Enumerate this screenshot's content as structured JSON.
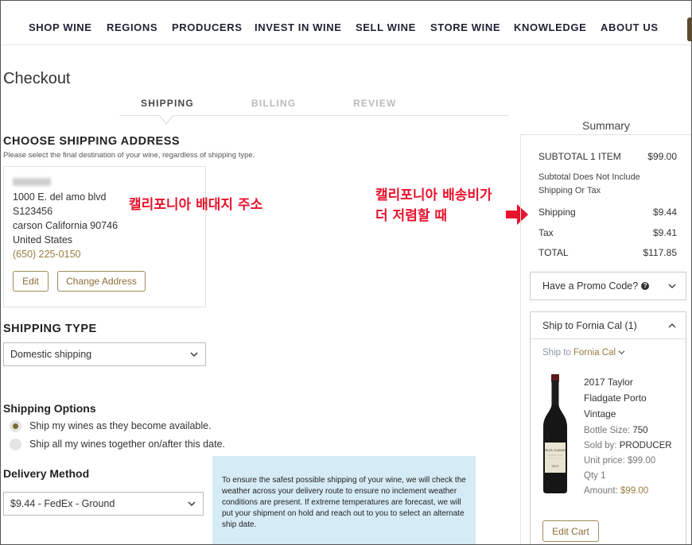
{
  "nav": {
    "items": [
      "SHOP WINE",
      "REGIONS",
      "PRODUCERS",
      "INVEST IN WINE",
      "SELL WINE",
      "STORE WINE",
      "KNOWLEDGE",
      "ABOUT US"
    ]
  },
  "page": {
    "title": "Checkout"
  },
  "steps": [
    "SHIPPING",
    "BILLING",
    "REVIEW"
  ],
  "shipping_address": {
    "heading": "CHOOSE SHIPPING ADDRESS",
    "subtext": "Please select the final destination of your wine, regardless of shipping type.",
    "lines": [
      "1000 E. del amo blvd",
      "S123456",
      "carson California 90746",
      "United States"
    ],
    "phone": "(650) 225-0150",
    "edit_label": "Edit",
    "change_label": "Change Address"
  },
  "annotations": {
    "address_note": "캘리포니아 배대지 주소",
    "shipping_note_line1": "캘리포니아 배송비가",
    "shipping_note_line2": "더 저렴할 때"
  },
  "shipping_type": {
    "heading": "SHIPPING TYPE",
    "selected": "Domestic shipping"
  },
  "shipping_options": {
    "heading": "Shipping Options",
    "options": [
      "Ship my wines as they become available.",
      "Ship all my wines together on/after this date."
    ],
    "selected_index": 0
  },
  "delivery": {
    "heading": "Delivery Method",
    "selected": "$9.44 - FedEx - Ground",
    "info": "To ensure the safest possible shipping of your wine, we will check the weather across your delivery route to ensure no inclement weather conditions are present. If extreme temperatures are forecast, we will put your shipment on hold and reach out to you to select an alternate ship date."
  },
  "summary": {
    "heading": "Summary",
    "subtotal_label": "SUBTOTAL 1 ITEM",
    "subtotal_value": "$99.00",
    "note": "Subtotal Does Not Include Shipping Or Tax",
    "shipping_label": "Shipping",
    "shipping_value": "$9.44",
    "tax_label": "Tax",
    "tax_value": "$9.41",
    "total_label": "TOTAL",
    "total_value": "$117.85",
    "promo_label": "Have a Promo Code?",
    "ship_to_header": "Ship to Fornia Cal (1)",
    "ship_to_prefix": "Ship to",
    "ship_to_location": "Fornia Cal",
    "product": {
      "name": "2017 Taylor Fladgate Porto Vintage",
      "bottle_size_label": "Bottle Size:",
      "bottle_size": "750",
      "sold_by_label": "Sold by:",
      "sold_by": "PRODUCER",
      "unit_price": "Unit price: $99.00",
      "qty": "Qty 1",
      "amount_label": "Amount:",
      "amount": "$99.00",
      "bottle_label_text": "TAYLOR, FLADGATE",
      "bottle_year": "2017"
    },
    "edit_cart_label": "Edit Cart"
  },
  "colors": {
    "accent_gold": "#9a7c3e",
    "annotation_red": "#e8132c",
    "info_bg": "#d5ebf5"
  }
}
